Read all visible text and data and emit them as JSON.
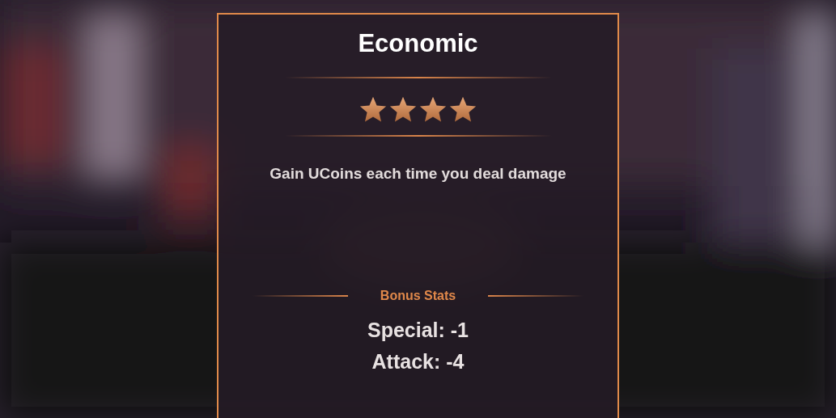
{
  "card": {
    "title": "Economic",
    "stars": 4,
    "description": "Gain UCoins each time you deal damage",
    "bonus_heading": "Bonus Stats",
    "stats": [
      "Special: -1",
      "Attack: -4"
    ]
  }
}
